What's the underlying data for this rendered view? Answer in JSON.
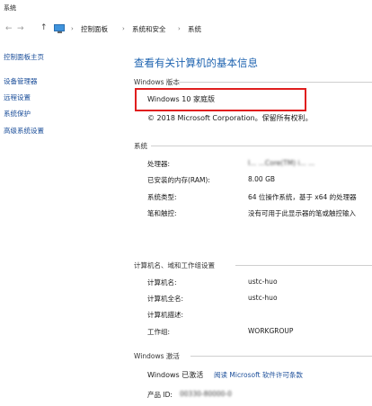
{
  "window_title": "系统",
  "address_bar": {
    "back": "←",
    "forward": "→",
    "up": "↑",
    "breadcrumbs": [
      "控制面板",
      "系统和安全",
      "系统"
    ]
  },
  "sidebar": {
    "home": "控制面板主页",
    "items": [
      "设备管理器",
      "远程设置",
      "系统保护",
      "高级系统设置"
    ]
  },
  "main": {
    "title": "查看有关计算机的基本信息",
    "edition_section": "Windows 版本",
    "edition": "Windows 10  家庭版",
    "copyright": "© 2018 Microsoft Corporation。保留所有权利。",
    "system_section": "系统",
    "system_rows": [
      {
        "label": "处理器:",
        "value": "I...  ...Core(TM) i... ..."
      },
      {
        "label": "已安装的内存(RAM):",
        "value": "8.00 GB"
      },
      {
        "label": "系统类型:",
        "value": "64 位操作系统，基于 x64 的处理器"
      },
      {
        "label": "笔和触控:",
        "value": "没有可用于此显示器的笔或触控输入"
      }
    ],
    "computer_section": "计算机名、域和工作组设置",
    "computer_rows": [
      {
        "label": "计算机名:",
        "value": "ustc-huo"
      },
      {
        "label": "计算机全名:",
        "value": "ustc-huo"
      },
      {
        "label": "计算机描述:",
        "value": ""
      },
      {
        "label": "工作组:",
        "value": "WORKGROUP"
      }
    ],
    "activation_section": "Windows 激活",
    "activation_status": "Windows 已激活",
    "activation_link": "阅读 Microsoft 软件许可条款",
    "product_id_label": "产品 ID:",
    "product_id_value": "00330-80000-0"
  },
  "colors": {
    "title_blue": "#1e63b0",
    "link_blue": "#1a4d99",
    "highlight_red": "#e01e1e"
  }
}
